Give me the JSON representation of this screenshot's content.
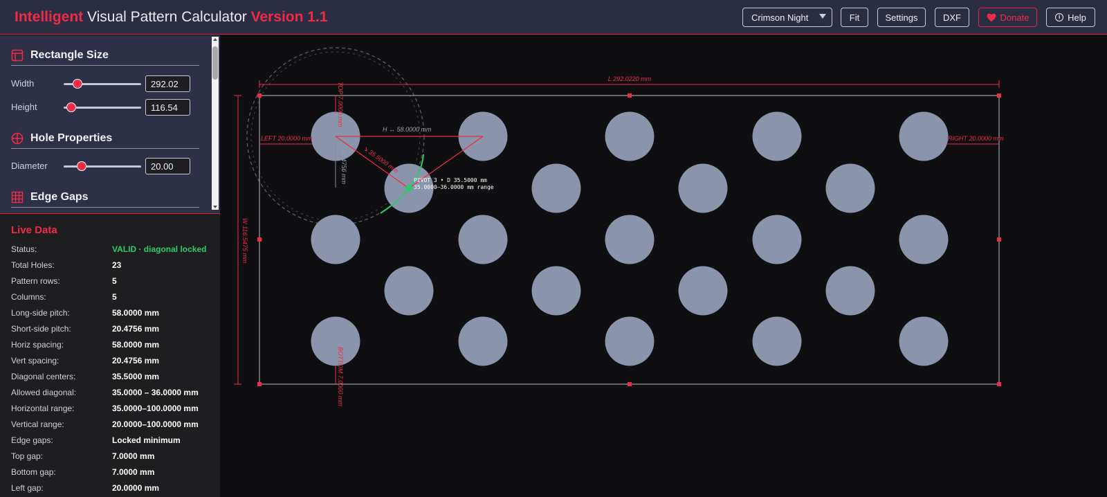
{
  "header": {
    "title_brand": "Intelligent",
    "title_name": " Visual Pattern Calculator ",
    "title_version": "Version 1.1",
    "theme_selected": "Crimson Night",
    "fit_label": "Fit",
    "settings_label": "Settings",
    "dxf_label": "DXF",
    "donate_label": "Donate",
    "help_label": "Help",
    "help_icon_glyph": "i"
  },
  "controls": {
    "rectangle": {
      "title": "Rectangle Size",
      "width_label": "Width",
      "width_value": "292.02",
      "width_slider_level": 0.16,
      "height_label": "Height",
      "height_value": "116.54",
      "height_slider_level": 0.04
    },
    "hole": {
      "title": "Hole Properties",
      "diameter_label": "Diameter",
      "diameter_value": "20.00",
      "diameter_slider_level": 0.21
    },
    "edge": {
      "title": "Edge Gaps"
    }
  },
  "live": {
    "title": "Live Data",
    "rows": [
      {
        "key": "Status:",
        "value": "VALID · diagonal locked",
        "ok": true
      },
      {
        "key": "Total Holes:",
        "value": "23"
      },
      {
        "key": "Pattern rows:",
        "value": "5"
      },
      {
        "key": "Columns:",
        "value": "5"
      },
      {
        "key": "Long-side pitch:",
        "value": "58.0000 mm"
      },
      {
        "key": "Short-side pitch:",
        "value": "20.4756 mm"
      },
      {
        "key": "Horiz spacing:",
        "value": "58.0000 mm"
      },
      {
        "key": "Vert spacing:",
        "value": "20.4756 mm"
      },
      {
        "key": "Diagonal centers:",
        "value": "35.5000 mm"
      },
      {
        "key": "Allowed diagonal:",
        "value": "35.0000 – 36.0000 mm"
      },
      {
        "key": "Horizontal range:",
        "value": "35.0000–100.0000 mm"
      },
      {
        "key": "Vertical range:",
        "value": "20.0000–100.0000 mm"
      },
      {
        "key": "Edge gaps:",
        "value": "Locked minimum"
      },
      {
        "key": "Top gap:",
        "value": "7.0000 mm"
      },
      {
        "key": "Bottom gap:",
        "value": "7.0000 mm"
      },
      {
        "key": "Left gap:",
        "value": "20.0000 mm"
      }
    ]
  },
  "canvas": {
    "dim_length": "L 292.0220 mm",
    "dim_width": "W 116.5475 mm",
    "gap_top": "TOP 7.0000 mm",
    "gap_bottom": "BOTTOM 7.0000 mm",
    "gap_left": "LEFT 20.0000 mm",
    "gap_right": "RIGHT 20.0000 mm",
    "h_spacing": "H ↔ 58.0000 mm",
    "v_spacing": "↕ 20.4756 mm",
    "diag_label": "↘ 35.5000 mm",
    "pivot_line1": "PIVOT 3  •  D 35.5000 mm",
    "pivot_line2": "35.0000–36.0000 mm range",
    "colors": {
      "accent": "#ef2b45",
      "hole": "#8a94ab",
      "green": "#2ec96a",
      "outline": "#b9bcc8"
    }
  }
}
